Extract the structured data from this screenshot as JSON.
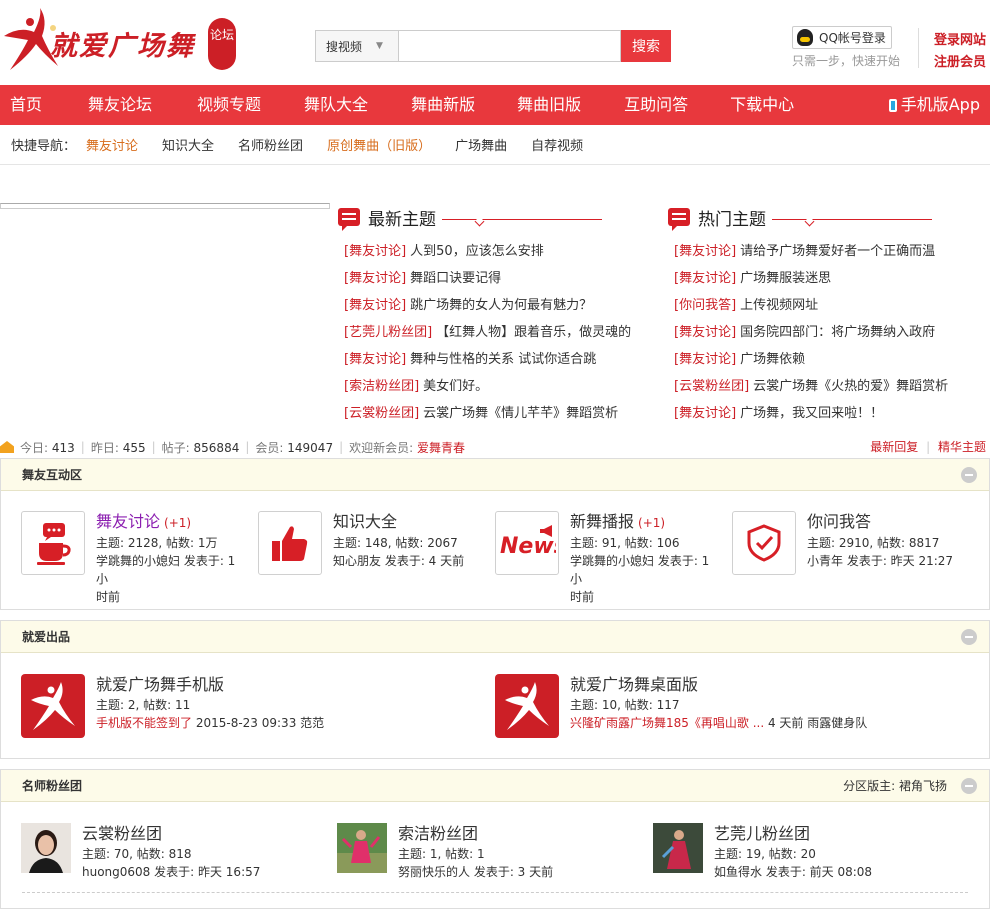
{
  "header": {
    "logo_text": "就爱广场舞",
    "logo_seal": "论坛",
    "search_select": "搜视频",
    "search_placeholder": "",
    "search_button": "搜索",
    "qq_login": "QQ帐号登录",
    "qq_sub": "只需一步，快速开始",
    "login": "登录网站",
    "register": "注册会员"
  },
  "nav": {
    "items": [
      "首页",
      "舞友论坛",
      "视频专题",
      "舞队大全",
      "舞曲新版",
      "舞曲旧版",
      "互助问答",
      "下载中心"
    ],
    "mobile": "手机版App"
  },
  "quick": {
    "label": "快捷导航：",
    "links": [
      "舞友讨论",
      "知识大全",
      "名师粉丝团",
      "原创舞曲（旧版）",
      "广场舞曲",
      "自荐视频"
    ]
  },
  "latest": {
    "title": "最新主题",
    "items": [
      {
        "cat": "[舞友讨论]",
        "text": "人到50，应该怎么安排"
      },
      {
        "cat": "[舞友讨论]",
        "text": "舞蹈口诀要记得"
      },
      {
        "cat": "[舞友讨论]",
        "text": "跳广场舞的女人为何最有魅力？"
      },
      {
        "cat": "[艺莞儿粉丝团]",
        "text": "【红舞人物】跟着音乐，做灵魂的"
      },
      {
        "cat": "[舞友讨论]",
        "text": "舞种与性格的关系 试试你适合跳"
      },
      {
        "cat": "[索洁粉丝团]",
        "text": "美女们好。"
      },
      {
        "cat": "[云裳粉丝团]",
        "text": "云裳广场舞《情儿芊芊》舞蹈赏析"
      }
    ]
  },
  "hot": {
    "title": "热门主题",
    "items": [
      {
        "cat": "[舞友讨论]",
        "text": "请给予广场舞爱好者一个正确而温"
      },
      {
        "cat": "[舞友讨论]",
        "text": "广场舞服装迷思"
      },
      {
        "cat": "[你问我答]",
        "text": "上传视频网址"
      },
      {
        "cat": "[舞友讨论]",
        "text": "国务院四部门：将广场舞纳入政府"
      },
      {
        "cat": "[舞友讨论]",
        "text": "广场舞依赖"
      },
      {
        "cat": "[云裳粉丝团]",
        "text": "云裳广场舞《火热的爱》舞蹈赏析"
      },
      {
        "cat": "[舞友讨论]",
        "text": "广场舞，我又回来啦！！"
      }
    ]
  },
  "stats": {
    "today_label": "今日:",
    "today": "413",
    "yesterday_label": "昨日:",
    "yesterday": "455",
    "posts_label": "帖子:",
    "posts": "856884",
    "members_label": "会员:",
    "members": "149047",
    "welcome_label": "欢迎新会员:",
    "newest": "爱舞青春",
    "sep": "|",
    "latest_reply": "最新回复",
    "digest": "精华主题"
  },
  "sections": {
    "s1": {
      "title": "舞友互动区",
      "forums": [
        {
          "name": "舞友讨论",
          "new": "(+1)",
          "counts": "主题: 2128, 帖数: 1万",
          "last1": "学跳舞的小媳妇 发表于: 1 小",
          "last2": "时前"
        },
        {
          "name": "知识大全",
          "new": "",
          "counts": "主题: 148, 帖数: 2067",
          "last1": "知心朋友 发表于: 4 天前",
          "last2": ""
        },
        {
          "name": "新舞播报",
          "new": "(+1)",
          "counts": "主题: 91, 帖数: 106",
          "last1": "学跳舞的小媳妇 发表于: 1 小",
          "last2": "时前"
        },
        {
          "name": "你问我答",
          "new": "",
          "counts": "主题: 2910, 帖数: 8817",
          "last1": "小青年 发表于: 昨天 21:27",
          "last2": ""
        }
      ]
    },
    "s2": {
      "title": "就爱出品",
      "forums": [
        {
          "name": "就爱广场舞手机版",
          "counts": "主题: 2, 帖数: 11",
          "last_title": "手机版不能签到了",
          "last_meta": " 2015-8-23 09:33 范范"
        },
        {
          "name": "就爱广场舞桌面版",
          "counts": "主题: 10, 帖数: 117",
          "last_title": "兴隆矿雨露广场舞185《再唱山歌 ...",
          "last_meta": " 4 天前 雨露健身队"
        }
      ]
    },
    "s3": {
      "title": "名师粉丝团",
      "moderator": "分区版主: 裙角飞扬",
      "forums": [
        {
          "name": "云裳粉丝团",
          "counts": "主题: 70, 帖数: 818",
          "last": "huong0608 发表于: 昨天 16:57"
        },
        {
          "name": "索洁粉丝团",
          "counts": "主题: 1, 帖数: 1",
          "last": "努丽快乐的人 发表于: 3 天前"
        },
        {
          "name": "艺莞儿粉丝团",
          "counts": "主题: 19, 帖数: 20",
          "last": "如鱼得水 发表于: 前天 08:08"
        }
      ]
    }
  },
  "icons": {
    "accent": "#e8383d",
    "brand": "#cc1f26",
    "logo": "dancer-logo-icon",
    "search_caret": "chevron-down-icon",
    "qq": "qq-penguin-icon",
    "mobile": "phone-icon",
    "home": "home-icon",
    "latest": "chat-bubble-icon",
    "hot": "chat-bubble-icon",
    "forum1": "coffee-chat-icon",
    "forum2": "thumbs-up-icon",
    "forum3": "news-icon",
    "forum4": "shield-check-icon",
    "app": "dancer-app-icon",
    "collapse": "collapse-icon"
  }
}
